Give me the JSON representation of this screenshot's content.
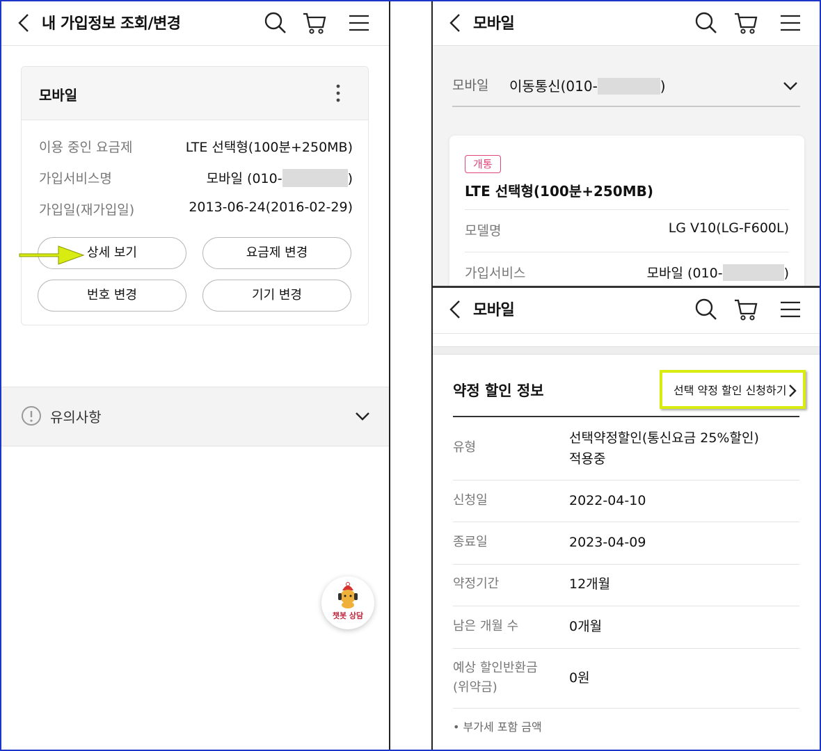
{
  "left": {
    "header_title": "내 가입정보 조회/변경",
    "card_title": "모바일",
    "rows": [
      {
        "label": "이용 중인 요금제",
        "value": "LTE 선택형(100분+250MB)"
      },
      {
        "label": "가입서비스명",
        "value_prefix": "모바일 (010-",
        "value_suffix": ")"
      },
      {
        "label": "가입일(재가입일)",
        "value": "2013-06-24(2016-02-29)"
      }
    ],
    "buttons": {
      "detail": "상세 보기",
      "plan_change": "요금제 변경",
      "number_change": "번호 변경",
      "device_change": "기기 변경"
    },
    "notice": "유의사항",
    "chatbot_label": "챗봇 상담"
  },
  "right_top": {
    "header_title": "모바일",
    "selector_label": "모바일",
    "selector_value_prefix": "이동통신(010-",
    "selector_value_suffix": ")",
    "badge": "개통",
    "plan_name": "LTE 선택형(100분+250MB)",
    "rows": [
      {
        "label": "모델명",
        "value": "LG V10(LG-F600L)"
      },
      {
        "label": "가입서비스",
        "value_prefix": "모바일 (010-",
        "value_suffix": ")"
      }
    ]
  },
  "right_bottom": {
    "header_title": "모바일",
    "section_title": "약정 할인 정보",
    "apply_button": "선택 약정 할인 신청하기",
    "rows": [
      {
        "label": "유형",
        "value_line1": "선택약정할인(통신요금 25%할인)",
        "value_line2": "적용중"
      },
      {
        "label": "신청일",
        "value": "2022-04-10"
      },
      {
        "label": "종료일",
        "value": "2023-04-09"
      },
      {
        "label": "약정기간",
        "value": "12개월"
      },
      {
        "label": "남은 개월 수",
        "value": "0개월"
      },
      {
        "label_line1": "예상 할인반환금",
        "label_line2": "(위약금)",
        "value": "0원"
      }
    ],
    "footnote": "• 부가세 포함 금액"
  },
  "icons": [
    "back-icon",
    "search-icon",
    "cart-icon",
    "menu-icon",
    "kebab-icon",
    "chevron-down-icon",
    "alert-icon",
    "chevron-right-icon",
    "arrow-pointer-icon",
    "chatbot-icon"
  ],
  "colors": {
    "highlight": "#d8ec12",
    "badge": "#e1457a",
    "frame": "#1b36c8"
  }
}
